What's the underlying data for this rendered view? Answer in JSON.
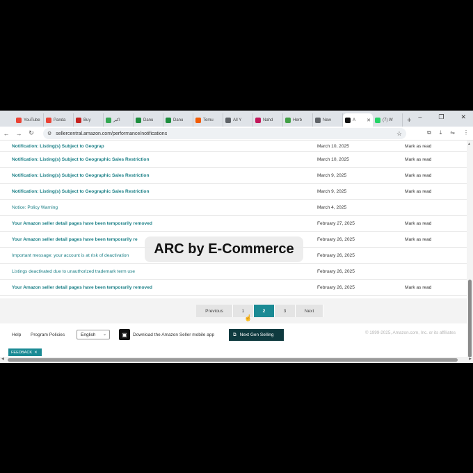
{
  "browser": {
    "tabs": [
      {
        "label": "YouTube",
        "icon": "gmail-icon",
        "color": "#ea4335"
      },
      {
        "label": "Panda",
        "icon": "gmail-icon",
        "color": "#ea4335"
      },
      {
        "label": "Buy",
        "icon": "mail-icon",
        "color": "#c5221f"
      },
      {
        "label": "اكبر",
        "icon": "flag-icon",
        "color": "#34a853"
      },
      {
        "label": "Danu",
        "icon": "sheet-icon",
        "color": "#1e8e3e"
      },
      {
        "label": "Danu",
        "icon": "sheet-icon",
        "color": "#1e8e3e"
      },
      {
        "label": "Temu",
        "icon": "temu-icon",
        "color": "#f25c05"
      },
      {
        "label": "All Y",
        "icon": "globe-icon",
        "color": "#5f6368"
      },
      {
        "label": "Nahd",
        "icon": "heart-icon",
        "color": "#c2185b"
      },
      {
        "label": "Herb",
        "icon": "leaf-icon",
        "color": "#43a047"
      },
      {
        "label": "New",
        "icon": "globe-icon",
        "color": "#5f6368"
      },
      {
        "label": "A",
        "icon": "amazon-icon",
        "color": "#111111",
        "active": true
      },
      {
        "label": "(7) W",
        "icon": "whatsapp-icon",
        "color": "#25d366"
      }
    ],
    "new_tab": "+",
    "window_controls": {
      "minimize": "–",
      "restore": "❐",
      "close": "✕"
    },
    "url": "sellercentral.amazon.com/performance/notifications"
  },
  "notifications": [
    {
      "title": "Notification: Listing(s) Subject to Geograp",
      "date": "March 10, 2025",
      "action": "Mark as read",
      "bold": true
    },
    {
      "title": "Notification: Listing(s) Subject to Geographic Sales Restriction",
      "date": "March 10, 2025",
      "action": "Mark as read",
      "bold": true
    },
    {
      "title": "Notification: Listing(s) Subject to Geographic Sales Restriction",
      "date": "March 9, 2025",
      "action": "Mark as read",
      "bold": true
    },
    {
      "title": "Notification: Listing(s) Subject to Geographic Sales Restriction",
      "date": "March 9, 2025",
      "action": "Mark as read",
      "bold": true
    },
    {
      "title": "Notice: Policy Warning",
      "date": "March 4, 2025",
      "action": "",
      "bold": false
    },
    {
      "title": "Your Amazon seller detail pages have been temporarily removed",
      "date": "February 27, 2025",
      "action": "Mark as read",
      "bold": true
    },
    {
      "title": "Your Amazon seller detail pages have been temporarily re",
      "date": "February 26, 2025",
      "action": "Mark as read",
      "bold": true
    },
    {
      "title": "Important message: your account is at risk of deactivation",
      "date": "February 26, 2025",
      "action": "",
      "bold": false
    },
    {
      "title": "Listings deactivated due to unauthorized trademark term use",
      "date": "February 26, 2025",
      "action": "",
      "bold": false
    },
    {
      "title": "Your Amazon seller detail pages have been temporarily removed",
      "date": "February 26, 2025",
      "action": "Mark as read",
      "bold": true
    }
  ],
  "pagination": {
    "previous": "Previous",
    "pages": [
      "1",
      "2",
      "3"
    ],
    "current": "2",
    "next": "Next"
  },
  "footer": {
    "help": "Help",
    "policies": "Program Policies",
    "language": "English",
    "app_promo": "Download the Amazon Seller mobile app",
    "next_gen": "Next Gen Selling",
    "copyright": "© 1999-2025, Amazon.com, Inc. or its affiliates"
  },
  "feedback": {
    "label": "FEEDBACK",
    "close": "✕"
  },
  "overlay_text": "ARC by E-Commerce",
  "colors": {
    "link": "#1a7f86",
    "accent": "#1a8a94",
    "dark_button": "#0e3a3f"
  }
}
